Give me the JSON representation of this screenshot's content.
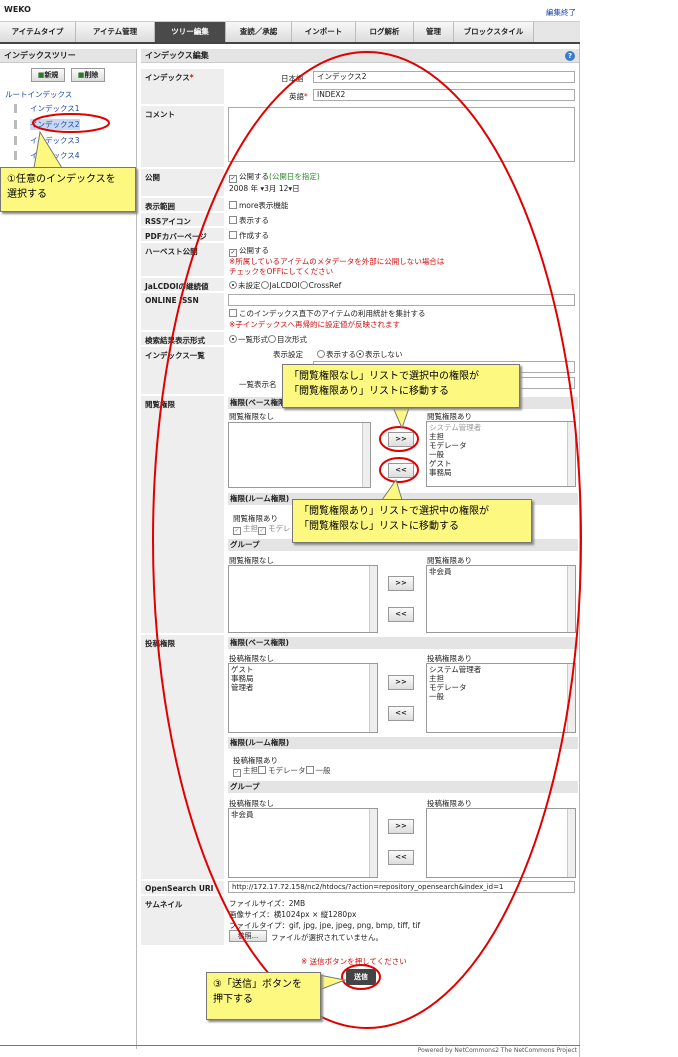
{
  "app_title": "WEKO",
  "edit_end": "編集終了",
  "tabs": [
    "アイテムタイプ",
    "アイテム管理",
    "ツリー編集",
    "査読／承認",
    "インポート",
    "ログ解析",
    "管理",
    "ブロックスタイル"
  ],
  "sidebar": {
    "title": "インデックスツリー",
    "new_btn": "新規",
    "delete_btn": "削除",
    "root": "ルートインデックス",
    "items": [
      "インデックス1",
      "インデックス2",
      "インデックス3",
      "インデックス4"
    ]
  },
  "main": {
    "title": "インデックス編集",
    "help_icon": "?",
    "index_label": "インデックス",
    "japanese_label": "日本語",
    "japanese_value": "インデックス2",
    "english_label": "英語",
    "english_value": "INDEX2",
    "comment_label": "コメント",
    "public_label": "公開",
    "public_check": "公開する",
    "public_date_link": "(公開日を指定)",
    "date_year": "2008",
    "date_year_unit": "年",
    "date_month": "3",
    "date_month_unit": "月",
    "date_day": "12",
    "date_day_unit": "日",
    "display_label": "表示範囲",
    "display_check": "more表示機能",
    "rss_label": "RSSアイコン",
    "rss_check": "表示する",
    "pdf_label": "PDFカバーページ",
    "pdf_check": "作成する",
    "harvest_label": "ハーベスト公開",
    "harvest_check": "公開する",
    "harvest_note1": "※所属しているアイテムのメタデータを外部に公開しない場合は",
    "harvest_note2": "チェックをOFFにしてください",
    "jalc_label": "JaLCDOIの継続値",
    "jalc_opt1": "未設定",
    "jalc_opt2": "JaLCDOI",
    "jalc_opt3": "CrossRef",
    "issn_label": "ONLINE ISSN",
    "issn_check": "このインデックス直下のアイテムの利用統計を集計する",
    "issn_note": "※子インデックスへ再帰的に設定値が反映されます",
    "search_label": "検索結果表示形式",
    "search_opt1": "一覧形式",
    "search_opt2": "目次形式",
    "list_label": "インデックス一覧",
    "list_display": "表示設定",
    "list_show": "表示する",
    "list_hide": "表示しない",
    "list_row2": "一覧",
    "list_row3": "一覧表示名",
    "view_label": "閲覧権限",
    "base_perm": "権限(ベース権限)",
    "room_perm": "権限(ルーム権限)",
    "group": "グループ",
    "no_perm": "閲覧権限なし",
    "has_perm": "閲覧権限あり",
    "view_has_list": [
      "システム管理者",
      "主担",
      "モデレータ",
      "一般",
      "ゲスト",
      "事務局"
    ],
    "room_has": "閲覧権限あり",
    "room_opts": [
      "主担",
      "モデレ"
    ],
    "group_has_list": [
      "非会員"
    ],
    "post_label": "投稿権限",
    "post_base": "権限(ベース権限)",
    "post_no": "投稿権限なし",
    "post_has": "投稿権限あり",
    "post_no_list": [
      "ゲスト",
      "事務局",
      "管理者"
    ],
    "post_has_list": [
      "システム管理者",
      "主担",
      "モデレータ",
      "一般"
    ],
    "post_room": "権限(ルーム権限)",
    "post_room_has": "投稿権限あり",
    "post_room_opts": [
      "主担",
      "モデレータ",
      "一般"
    ],
    "post_group": "グループ",
    "post_group_no": "投稿権限なし",
    "post_group_has": "投稿権限あり",
    "post_group_no_list": [
      "非会員"
    ],
    "move_right": ">>",
    "move_left": "<<",
    "opensearch_label": "OpenSearch URI",
    "opensearch_value": "http://172.17.72.158/nc2/htdocs/?action=repository_opensearch&index_id=1",
    "thumb_label": "サムネイル",
    "thumb_size": "ファイルサイズ：2MB",
    "thumb_img": "画像サイズ：横1024px × 縦1280px",
    "thumb_type": "ファイルタイプ：gif, jpg, jpe, jpeg, png, bmp, tiff, tif",
    "browse_btn": "参照...",
    "no_file": "ファイルが選択されていません。",
    "submit_note": "※ 送信ボタンを押してください",
    "submit_btn": "送信"
  },
  "callouts": {
    "c1": "①任意のインデックスを\n選択する",
    "c2": "「閲覧権限なし」リストで選択中の権限が\n「閲覧権限あり」リストに移動する",
    "c3": "「閲覧権限あり」リストで選択中の権限が\n「閲覧権限なし」リストに移動する",
    "c4": "③「送信」ボタンを\n押下する"
  },
  "footer": "Powered by NetCommons2 The NetCommons Project",
  "colors": {
    "annotation_red": "#e00000",
    "callout_yellow": "#fdf980",
    "link_blue": "#1a47a8"
  }
}
